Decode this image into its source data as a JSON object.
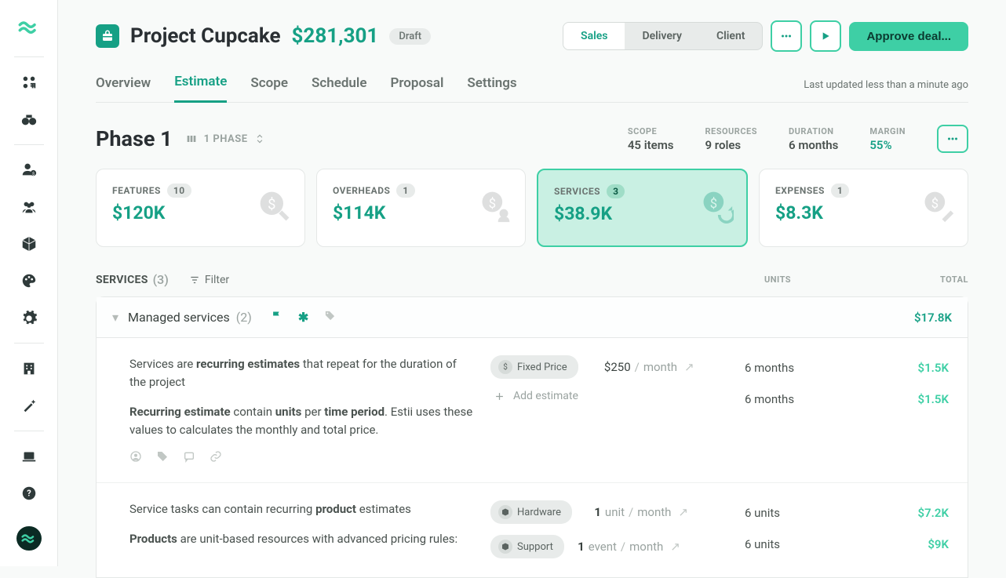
{
  "header": {
    "project_name": "Project Cupcake",
    "amount": "$281,301",
    "status": "Draft",
    "view_tabs": [
      "Sales",
      "Delivery",
      "Client"
    ],
    "active_view_tab": "Sales",
    "approve_label": "Approve deal...",
    "nav_tabs": [
      "Overview",
      "Estimate",
      "Scope",
      "Schedule",
      "Proposal",
      "Settings"
    ],
    "active_nav_tab": "Estimate",
    "updated": "Last updated less than a minute ago"
  },
  "phase": {
    "title": "Phase 1",
    "selector": "1 PHASE",
    "stats": {
      "scope": {
        "label": "SCOPE",
        "value": "45 items"
      },
      "resources": {
        "label": "RESOURCES",
        "value": "9 roles"
      },
      "duration": {
        "label": "DURATION",
        "value": "6 months"
      },
      "margin": {
        "label": "MARGIN",
        "value": "55%"
      }
    }
  },
  "cards": [
    {
      "label": "FEATURES",
      "count": "10",
      "value": "$120K"
    },
    {
      "label": "OVERHEADS",
      "count": "1",
      "value": "$114K"
    },
    {
      "label": "SERVICES",
      "count": "3",
      "value": "$38.9K",
      "active": true
    },
    {
      "label": "EXPENSES",
      "count": "1",
      "value": "$8.3K"
    }
  ],
  "table": {
    "header_label": "SERVICES",
    "header_count": "(3)",
    "filter_label": "Filter",
    "col_units": "UNITS",
    "col_total": "TOTAL"
  },
  "group": {
    "title": "Managed services",
    "count": "(2)",
    "total": "$17.8K"
  },
  "row1": {
    "text1a": "Services are ",
    "text1b": "recurring estimates",
    "text1c": " that repeat for the duration of the project",
    "text2a": "Recurring estimate",
    "text2b": " contain ",
    "text2c": "units",
    "text2d": " per ",
    "text2e": "time period",
    "text2f": ". Estii uses these values to calculates the monthly and total price.",
    "pill": "Fixed Price",
    "rate_price": "$250",
    "rate_unit": "month",
    "units1": "6 months",
    "units2": "6 months",
    "total1": "$1.5K",
    "total2": "$1.5K",
    "add_label": "Add estimate"
  },
  "row2": {
    "text1a": "Service tasks can contain recurring ",
    "text1b": "product",
    "text1c": " estimates",
    "text2a": "Products",
    "text2b": " are unit-based resources with advanced pricing rules:",
    "pill1": "Hardware",
    "rate1_qty": "1",
    "rate1_unit_a": "unit",
    "rate1_unit_b": "month",
    "pill2": "Support",
    "rate2_qty": "1",
    "rate2_unit_a": "event",
    "rate2_unit_b": "month",
    "units1": "6 units",
    "units2": "6 units",
    "total1": "$7.2K",
    "total2": "$9K"
  }
}
